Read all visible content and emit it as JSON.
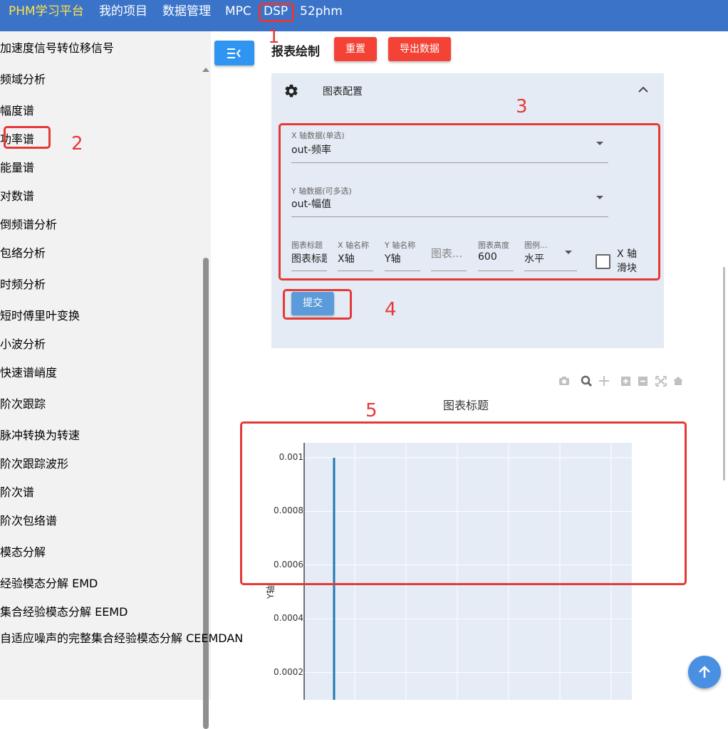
{
  "topnav": {
    "brand": "PHM学习平台",
    "items": [
      "我的项目",
      "数据管理",
      "MPC",
      "DSP",
      "52phm"
    ]
  },
  "sidebar": {
    "items": [
      {
        "type": "link",
        "label": "加速度信号转位移信号"
      },
      {
        "type": "heading",
        "label": "频域分析"
      },
      {
        "type": "link",
        "label": "幅度谱"
      },
      {
        "type": "link",
        "label": "功率谱"
      },
      {
        "type": "link",
        "label": "能量谱"
      },
      {
        "type": "link",
        "label": "对数谱"
      },
      {
        "type": "link",
        "label": "倒频谱分析"
      },
      {
        "type": "link",
        "label": "包络分析"
      },
      {
        "type": "heading",
        "label": "时频分析"
      },
      {
        "type": "link",
        "label": "短时傅里叶变换"
      },
      {
        "type": "link",
        "label": "小波分析"
      },
      {
        "type": "link",
        "label": "快速谱峭度"
      },
      {
        "type": "heading",
        "label": "阶次跟踪"
      },
      {
        "type": "link",
        "label": "脉冲转换为转速"
      },
      {
        "type": "link",
        "label": "阶次跟踪波形"
      },
      {
        "type": "link",
        "label": "阶次谱"
      },
      {
        "type": "link",
        "label": "阶次包络谱"
      },
      {
        "type": "heading",
        "label": "模态分解"
      },
      {
        "type": "link",
        "label": "经验模态分解 EMD"
      },
      {
        "type": "link",
        "label": "集合经验模态分解 EEMD"
      },
      {
        "type": "link",
        "label": "自适应噪声的完整集合经验模态分解 CEEMDAN"
      }
    ]
  },
  "main": {
    "title": "报表绘制",
    "reset_label": "重置",
    "export_label": "导出数据",
    "panel": {
      "title": "图表配置",
      "x_field": {
        "label": "X 轴数据(单选)",
        "value": "out-频率"
      },
      "y_field": {
        "label": "Y 轴数据(可多选)",
        "value": "out-幅值"
      },
      "chart_title": {
        "label": "图表标题",
        "value": "图表标题"
      },
      "x_name": {
        "label": "X 轴名称",
        "value": "X轴"
      },
      "y_name": {
        "label": "Y 轴名称",
        "value": "Y轴"
      },
      "chart_width_placeholder": "图表...",
      "chart_height": {
        "label": "图表高度",
        "value": "600"
      },
      "legend": {
        "label": "图例...",
        "value": "水平"
      },
      "slider_label": "X 轴滑块",
      "submit_label": "提交"
    }
  },
  "annotations": [
    "1",
    "2",
    "3",
    "4",
    "5"
  ],
  "chart_data": {
    "type": "line",
    "title": "图表标题",
    "ylabel": "Y轴",
    "yticks": [
      "0.001",
      "0.0008",
      "0.0006",
      "0.0004",
      "0.0002"
    ],
    "ytick_values": [
      0.001,
      0.0008,
      0.0006,
      0.0004,
      0.0002
    ],
    "series": [
      {
        "color": "#1f77b4",
        "spike_value": 0.001
      }
    ]
  }
}
